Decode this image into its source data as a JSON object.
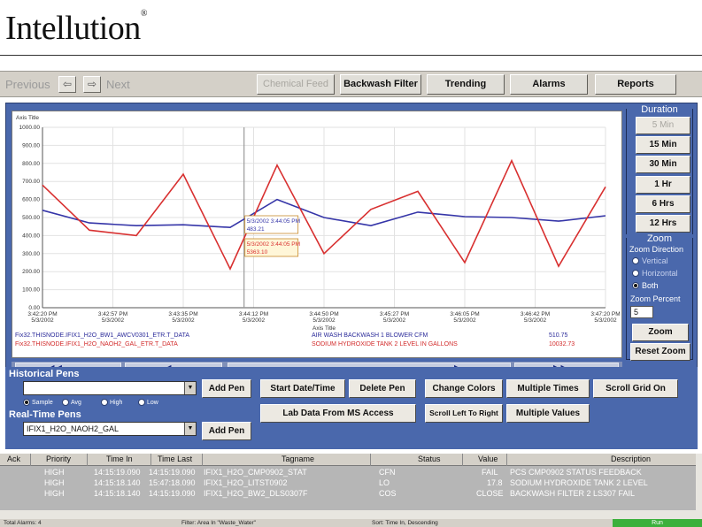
{
  "logo": {
    "text": "Intellution",
    "reg": "®"
  },
  "nav": {
    "previous_label": "Previous",
    "next_label": "Next",
    "back_arrow": "⇦",
    "forward_arrow": "⇨",
    "tabs": [
      {
        "label": "Chemical Feed",
        "enabled": false
      },
      {
        "label": "Backwash Filter",
        "enabled": true
      },
      {
        "label": "Trending",
        "enabled": true
      },
      {
        "label": "Alarms",
        "enabled": true
      },
      {
        "label": "Reports",
        "enabled": true
      }
    ]
  },
  "chart": {
    "y_axis_title": "Axis Title",
    "x_axis_title": "Axis Title",
    "y_ticks": [
      "1000.00",
      "900.00",
      "800.00",
      "700.00",
      "600.00",
      "500.00",
      "400.00",
      "300.00",
      "200.00",
      "100.00",
      "0.00"
    ],
    "x_ticks": [
      {
        "time": "3:42:20 PM",
        "date": "5/3/2002"
      },
      {
        "time": "3:42:57 PM",
        "date": "5/3/2002"
      },
      {
        "time": "3:43:35 PM",
        "date": "5/3/2002"
      },
      {
        "time": "3:44:12 PM",
        "date": "5/3/2002"
      },
      {
        "time": "3:44:50 PM",
        "date": "5/3/2002"
      },
      {
        "time": "3:45:27 PM",
        "date": "5/3/2002"
      },
      {
        "time": "3:46:05 PM",
        "date": "5/3/2002"
      },
      {
        "time": "3:46:42 PM",
        "date": "5/3/2002"
      },
      {
        "time": "3:47:20 PM",
        "date": "5/3/2002"
      }
    ],
    "blue_series": [
      540,
      470,
      455,
      460,
      445,
      600,
      500,
      455,
      530,
      505,
      500,
      480,
      510
    ],
    "red_series": [
      680,
      430,
      400,
      740,
      215,
      790,
      300,
      545,
      645,
      250,
      815,
      230,
      670
    ],
    "blue_color": "#3535a8",
    "red_color": "#d83030",
    "cursor_tooltips": [
      {
        "time": "5/3/2002 3:44:05 PM",
        "value": "483.21"
      },
      {
        "time": "5/3/2002 3:44:05 PM",
        "value": "5363.10"
      }
    ]
  },
  "pens": [
    {
      "tag": "Fix32.THISNODE.IFIX1_H2O_BW1_AWCV0301_ETR.T_DATA",
      "desc": "AIR WASH BACKWASH 1 BLOWER CFM",
      "value": "510.75"
    },
    {
      "tag": "Fix32.THISNODE.IFIX1_H2O_NAOH2_GAL_ETR.T_DATA",
      "desc": "SODIUM HYDROXIDE TANK 2 LEVEL IN GALLONS",
      "value": "10032.73"
    }
  ],
  "duration": {
    "title": "Duration",
    "buttons": [
      {
        "label": "5 Min",
        "enabled": false
      },
      {
        "label": "15 Min",
        "enabled": true
      },
      {
        "label": "30 Min",
        "enabled": true
      },
      {
        "label": "1 Hr",
        "enabled": true
      },
      {
        "label": "6 Hrs",
        "enabled": true
      },
      {
        "label": "12 Hrs",
        "enabled": true
      }
    ]
  },
  "zoom": {
    "title": "Zoom",
    "direction_label": "Zoom Direction",
    "options": [
      {
        "label": "Vertical",
        "selected": false
      },
      {
        "label": "Horizontal",
        "selected": false
      },
      {
        "label": "Both",
        "selected": true
      }
    ],
    "percent_label": "Zoom Percent",
    "percent_value": "5",
    "zoom_button": "Zoom",
    "reset_button": "Reset Zoom"
  },
  "controls": {
    "historical_label": "Historical Pens",
    "historical_value": "",
    "add_pen_label": "Add Pen",
    "sample_options": [
      {
        "label": "Sample",
        "selected": true
      },
      {
        "label": "Avg",
        "selected": false
      },
      {
        "label": "High",
        "selected": false
      },
      {
        "label": "Low",
        "selected": false
      }
    ],
    "realtime_label": "Real-Time Pens",
    "realtime_value": "IFIX1_H2O_NAOH2_GAL",
    "add_pen2_label": "Add Pen",
    "start_date_label": "Start Date/Time",
    "delete_pen_label": "Delete Pen",
    "change_colors_label": "Change Colors",
    "multiple_times_label": "Multiple Times",
    "scroll_grid_label": "Scroll Grid On",
    "lab_data_label": "Lab Data From MS Access",
    "scroll_left_label": "Scroll Left To Right",
    "multiple_values_label": "Multiple Values"
  },
  "alarms": {
    "headers": [
      "Ack",
      "Priority",
      "Time In",
      "Time Last",
      "Tagname",
      "Status",
      "Value",
      "Description"
    ],
    "rows": [
      {
        "ack": "",
        "priority": "HIGH",
        "time_in": "14:15:19.090",
        "time_last": "14:15:19.090",
        "tagname": "IFIX1_H2O_CMP0902_STAT",
        "status": "CFN",
        "value": "FAIL",
        "description": "PCS CMP0902 STATUS FEEDBACK"
      },
      {
        "ack": "",
        "priority": "HIGH",
        "time_in": "14:15:18.140",
        "time_last": "15:47:18.090",
        "tagname": "IFIX1_H2O_LITST0902",
        "status": "LO",
        "value": "17.8",
        "description": "SODIUM HYDROXIDE TANK 2 LEVEL"
      },
      {
        "ack": "",
        "priority": "HIGH",
        "time_in": "14:15:18.140",
        "time_last": "14:15:19.090",
        "tagname": "IFIX1_H2O_BW2_DLS0307F",
        "status": "COS",
        "value": "CLOSE",
        "description": "BACKWASH FILTER 2 LS307 FAIL"
      }
    ]
  },
  "status_bar": {
    "total": "Total Alarms: 4",
    "filter": "Filter: Area In \"Waste_Water\"",
    "sort": "Sort: Time In, Descending",
    "run": "Run"
  }
}
